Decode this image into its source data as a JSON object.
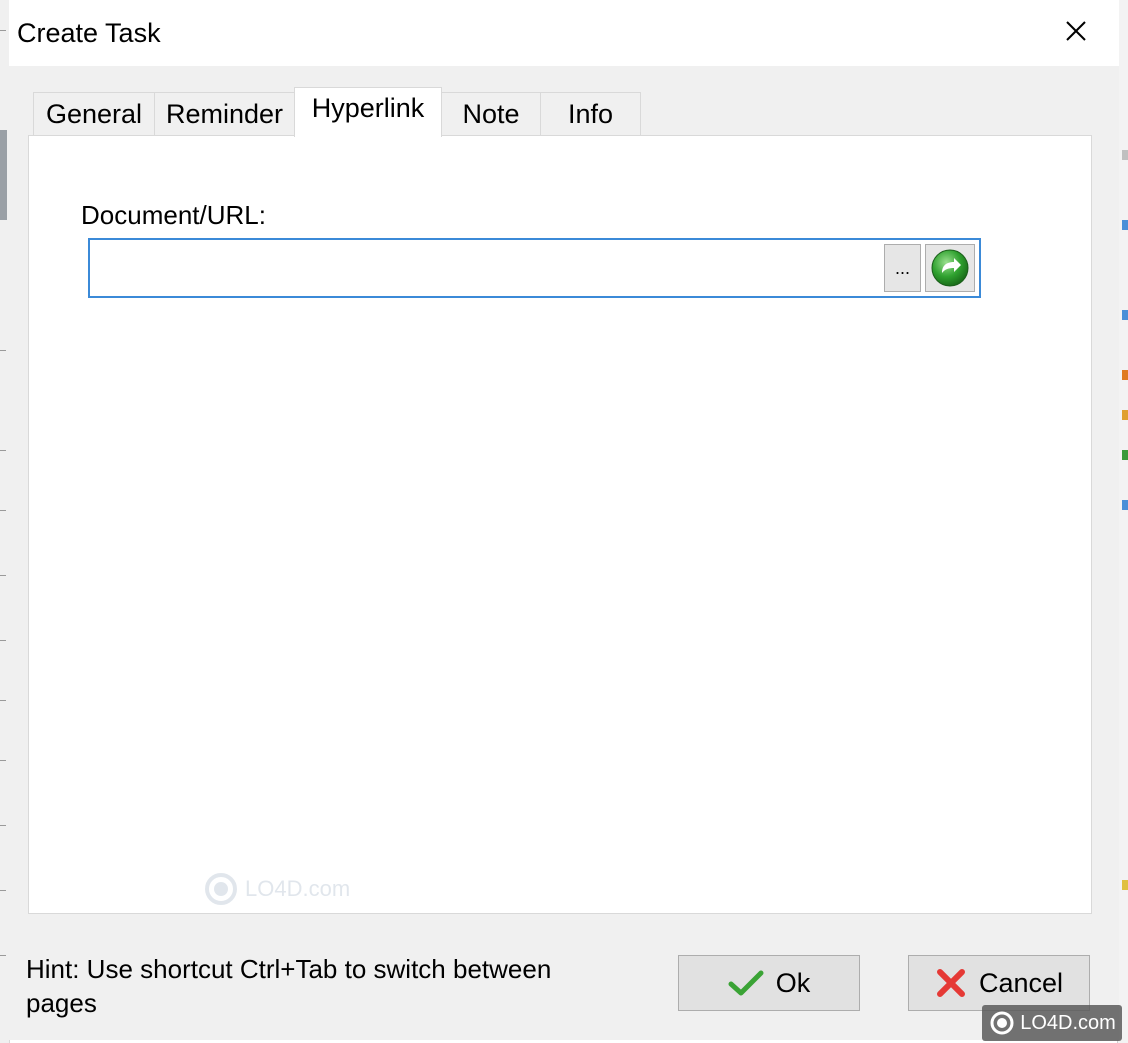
{
  "window": {
    "title": "Create Task",
    "close_symbol": "✕"
  },
  "tabs": [
    {
      "label": "General",
      "active": false
    },
    {
      "label": "Reminder",
      "active": false
    },
    {
      "label": "Hyperlink",
      "active": true
    },
    {
      "label": "Note",
      "active": false
    },
    {
      "label": "Info",
      "active": false
    }
  ],
  "hyperlink": {
    "label": "Document/URL:",
    "value": "",
    "placeholder": "",
    "browse_label": "...",
    "go_icon": "green-go-arrow-icon"
  },
  "footer": {
    "hint": "Hint: Use shortcut Ctrl+Tab to switch between pages",
    "ok_label": "Ok",
    "cancel_label": "Cancel"
  },
  "watermark": {
    "text": "LO4D.com"
  },
  "colors": {
    "focus_border": "#3b8ad8",
    "dialog_bg": "#f0f0f0",
    "ok_check": "#3aa335",
    "cancel_x": "#e53935",
    "go_green": "#2fa12f"
  }
}
